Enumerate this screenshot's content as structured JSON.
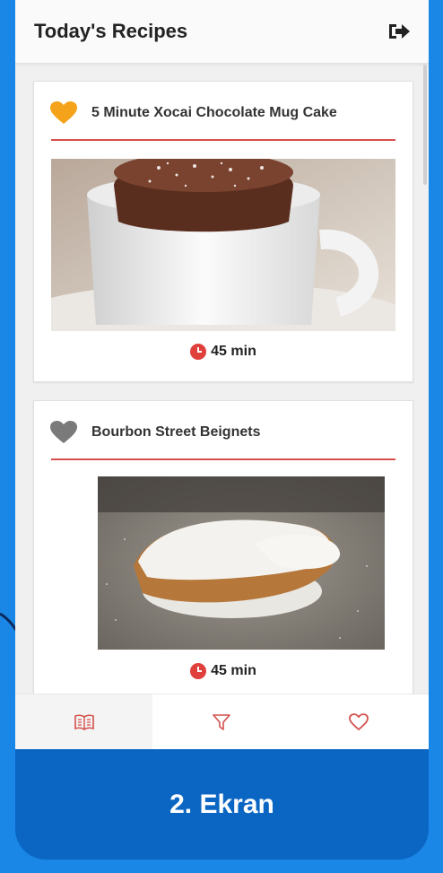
{
  "appbar": {
    "title": "Today's Recipes",
    "logout_icon": "logout-icon"
  },
  "recipes": [
    {
      "title": "5 Minute Xocai Chocolate Mug Cake",
      "favorite": true,
      "time": "45 min",
      "heart_color": "#f5a31a",
      "image": "chocolate-mug-cake-photo"
    },
    {
      "title": "Bourbon Street Beignets",
      "favorite": false,
      "time": "45 min",
      "heart_color": "#7a7a7a",
      "image": "beignets-photo"
    }
  ],
  "bottom_nav": [
    {
      "name": "recipes",
      "icon": "book-icon",
      "active": true
    },
    {
      "name": "filter",
      "icon": "filter-icon",
      "active": false
    },
    {
      "name": "favorites",
      "icon": "heart-outline-icon",
      "active": false
    }
  ],
  "caption": "2. Ekran",
  "colors": {
    "accent": "#d4504c",
    "favorite": "#f5a31a",
    "clock": "#e0403c",
    "background": "#1a86e6",
    "caption_panel": "#0b66c3"
  }
}
